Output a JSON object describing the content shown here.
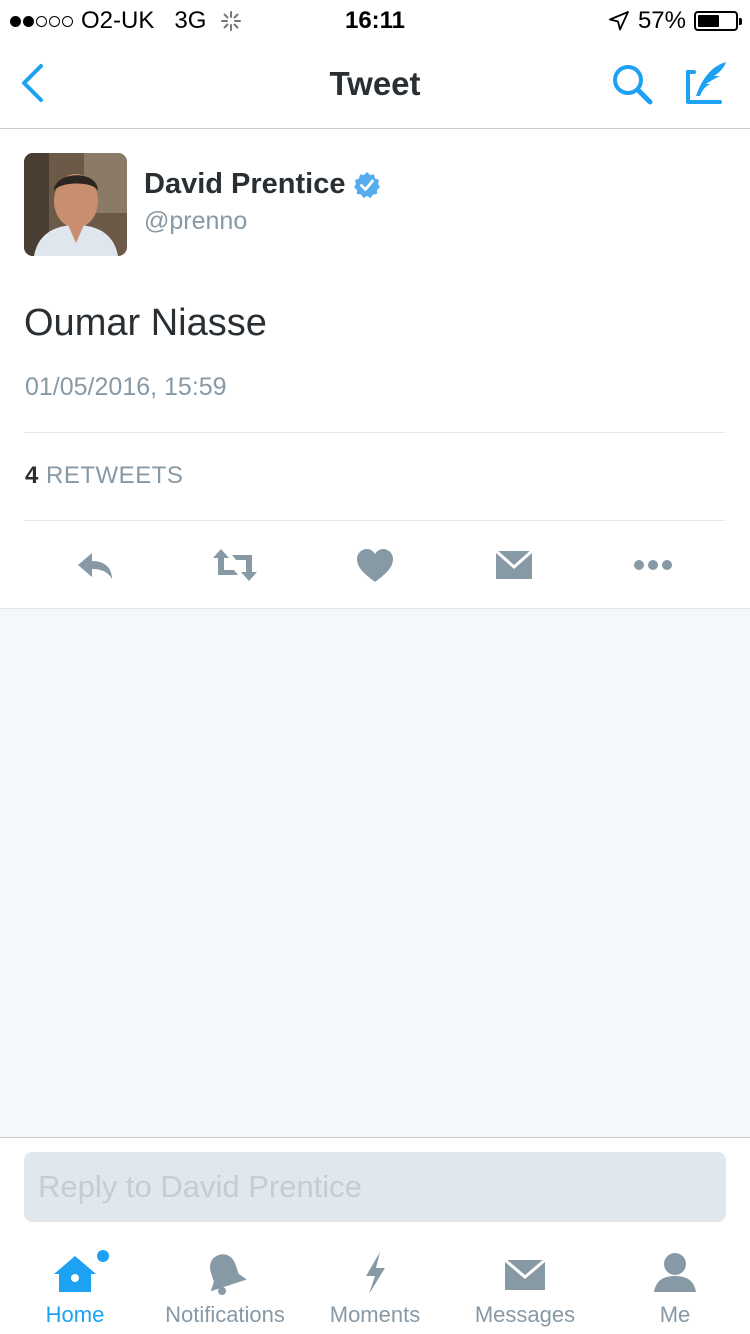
{
  "status_bar": {
    "carrier": "O2-UK",
    "network": "3G",
    "time": "16:11",
    "battery": "57%",
    "battery_level": 0.57,
    "signal_bars_filled": 2,
    "signal_bars_total": 5
  },
  "nav": {
    "title": "Tweet",
    "back_icon": "chevron-left-icon",
    "search_icon": "search-icon",
    "compose_icon": "compose-icon"
  },
  "tweet": {
    "author_name": "David Prentice",
    "handle": "@prenno",
    "verified": true,
    "text": "Oumar Niasse",
    "timestamp": "01/05/2016, 15:59",
    "retweet_count": "4",
    "retweets_label": "RETWEETS"
  },
  "actions": [
    "reply-icon",
    "retweet-icon",
    "like-icon",
    "direct-message-icon",
    "more-icon"
  ],
  "reply": {
    "placeholder": "Reply to David Prentice"
  },
  "tabs": [
    {
      "label": "Home",
      "icon": "home-icon",
      "active": true
    },
    {
      "label": "Notifications",
      "icon": "bell-icon",
      "active": false
    },
    {
      "label": "Moments",
      "icon": "lightning-icon",
      "active": false
    },
    {
      "label": "Messages",
      "icon": "envelope-icon",
      "active": false
    },
    {
      "label": "Me",
      "icon": "person-icon",
      "active": false
    }
  ],
  "colors": {
    "accent": "#1da1f2",
    "icon_gray": "#8899a6",
    "text": "#292f33",
    "background_gray": "#f5f8fa"
  }
}
